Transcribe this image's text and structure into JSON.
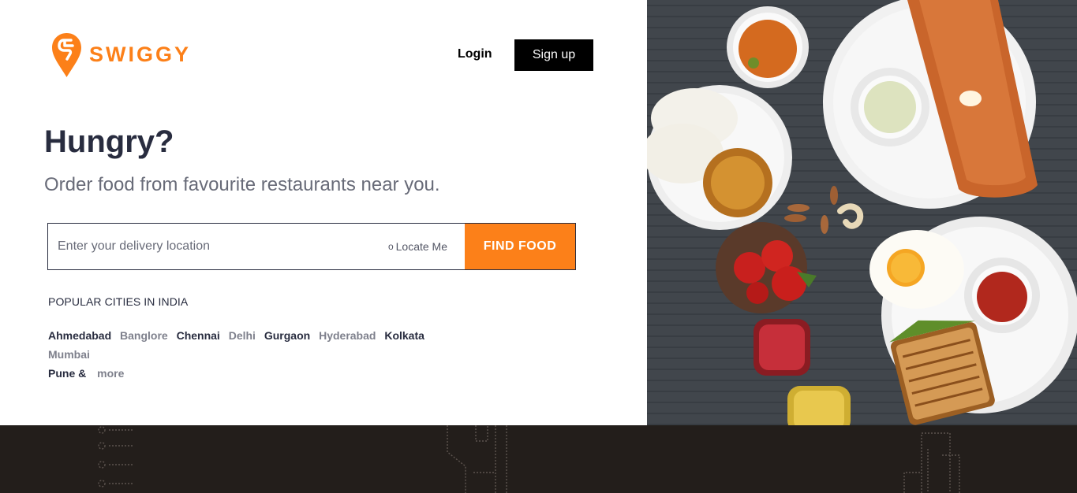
{
  "brand": {
    "name": "SWIGGY",
    "color": "#fc8019"
  },
  "header": {
    "login_label": "Login",
    "signup_label": "Sign up"
  },
  "hero": {
    "title": "Hungry?",
    "subtitle": "Order food from favourite restaurants near you."
  },
  "search": {
    "placeholder": "Enter your delivery location",
    "value": "",
    "locate_icon": "target-icon",
    "locate_label": "Locate Me",
    "find_label": "FIND FOOD"
  },
  "popular": {
    "heading": "POPULAR CITIES IN INDIA",
    "cities": [
      {
        "name": "Ahmedabad",
        "tone": "dark"
      },
      {
        "name": "Banglore",
        "tone": "light"
      },
      {
        "name": "Chennai",
        "tone": "dark"
      },
      {
        "name": "Delhi",
        "tone": "light"
      },
      {
        "name": "Gurgaon",
        "tone": "dark"
      },
      {
        "name": "Hyderabad",
        "tone": "light"
      },
      {
        "name": "Kolkata",
        "tone": "dark"
      },
      {
        "name": "Mumbai",
        "tone": "light"
      },
      {
        "name": "Pune &",
        "tone": "dark"
      },
      {
        "name": "more",
        "tone": "light"
      }
    ]
  },
  "colors": {
    "accent": "#fc8019",
    "text_dark": "#282c3f",
    "text_muted": "#686b78",
    "footer_bg": "#231e1b",
    "photo_bg": "#3d4248"
  }
}
